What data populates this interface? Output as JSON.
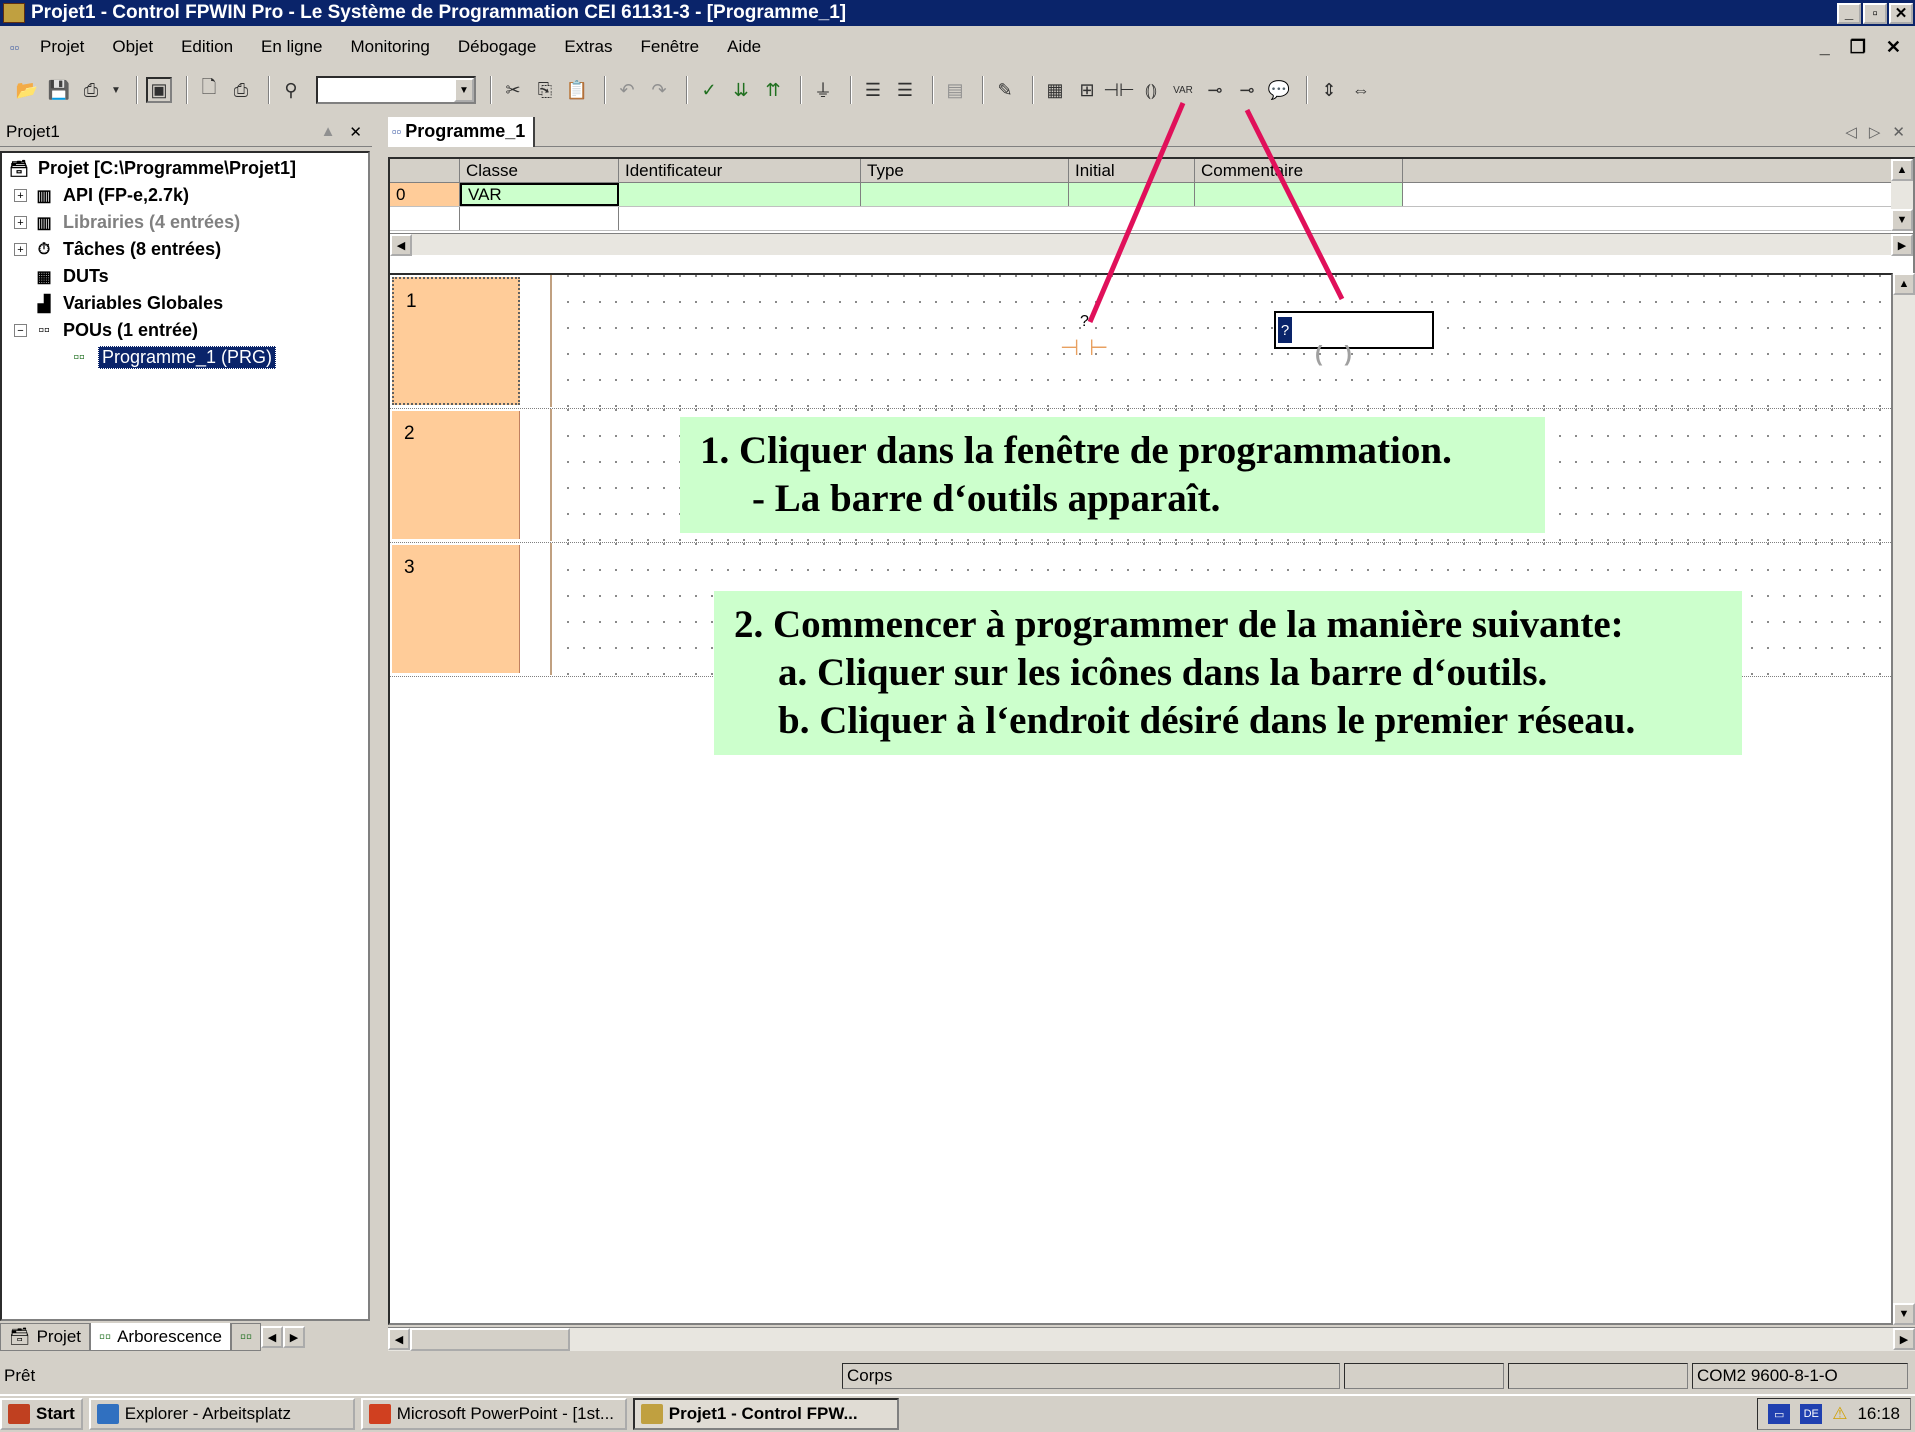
{
  "window": {
    "title": "Projet1 - Control FPWIN Pro - Le Système de Programmation CEI 61131-3 - [Programme_1]",
    "min": "_",
    "max": "▫",
    "close": "✕"
  },
  "menubar": {
    "items": [
      "Projet",
      "Objet",
      "Edition",
      "En ligne",
      "Monitoring",
      "Débogage",
      "Extras",
      "Fenêtre",
      "Aide"
    ],
    "mdi_min": "_",
    "mdi_restore": "❐",
    "mdi_close": "✕"
  },
  "toolbar": {
    "combo_value": "",
    "icons": [
      "open-icon",
      "save-icon",
      "print-preview-icon",
      "window-icon",
      "page-preview-icon",
      "print-icon",
      "find-icon",
      "cut-icon",
      "copy-icon",
      "paste-icon",
      "undo-icon",
      "redo-icon",
      "compile-icon",
      "build-icon",
      "rebuild-icon",
      "online-icon",
      "insert-network-before-icon",
      "insert-network-after-icon",
      "network-icon",
      "pen-icon",
      "var-icon",
      "function-block-icon",
      "contact-icon",
      "coil-icon",
      "var-box-icon",
      "set-icon",
      "reset-icon",
      "comment-icon",
      "vertical-icon",
      "horizontal-icon"
    ]
  },
  "leftpane": {
    "title": "Projet1",
    "tree": [
      {
        "label": "Projet [C:\\Programme\\Projet1]",
        "level": 0,
        "icon": "project-icon",
        "expander": ""
      },
      {
        "label": "API (FP-e,2.7k)",
        "level": 1,
        "icon": "plc-icon",
        "expander": "+"
      },
      {
        "label": "Librairies (4 entrées)",
        "level": 1,
        "icon": "library-icon",
        "expander": "+",
        "dim": true
      },
      {
        "label": "Tâches (8 entrées)",
        "level": 1,
        "icon": "task-icon",
        "expander": "+"
      },
      {
        "label": "DUTs",
        "level": 1,
        "icon": "dut-icon",
        "expander": ""
      },
      {
        "label": "Variables Globales",
        "level": 1,
        "icon": "global-vars-icon",
        "expander": ""
      },
      {
        "label": "POUs (1 entrée)",
        "level": 1,
        "icon": "pou-icon",
        "expander": "−"
      },
      {
        "label": "Programme_1 (PRG)",
        "level": 2,
        "icon": "program-icon",
        "expander": "",
        "selected": true
      }
    ],
    "tabs": [
      "Projet",
      "Arborescence"
    ]
  },
  "editor": {
    "tab": "Programme_1",
    "columns": [
      "",
      "Classe",
      "Identificateur",
      "Type",
      "Initial",
      "Commentaire"
    ],
    "rows": [
      {
        "num": "0",
        "classe": "VAR",
        "ident": "",
        "type": "",
        "initial": "",
        "comment": ""
      }
    ],
    "networks": [
      "1",
      "2",
      "3"
    ],
    "contact_label": "?",
    "varbox_value": "?"
  },
  "callouts": {
    "c1_line1": "1. Cliquer dans la fenêtre de programmation.",
    "c1_line2": "- La barre d‘outils apparaît.",
    "c2_line1": "2. Commencer à programmer de la manière suivante:",
    "c2_line2": "a. Cliquer sur les icônes dans la barre d‘outils.",
    "c2_line3": "b. Cliquer à l‘endroit désiré dans le premier réseau."
  },
  "statusbar": {
    "status": "Prêt",
    "section": "Corps",
    "comm": "COM2 9600-8-1-O"
  },
  "taskbar": {
    "start": "Start",
    "buttons": [
      "Explorer - Arbeitsplatz",
      "Microsoft PowerPoint - [1st...",
      "Projet1 - Control FPW..."
    ],
    "lang": "DE",
    "clock": "16:18"
  },
  "colors": {
    "titlebar": "#0a246a",
    "network_number": "#ffcc99",
    "callout_bg": "#ccffcc",
    "arrow": "#e0105a"
  }
}
